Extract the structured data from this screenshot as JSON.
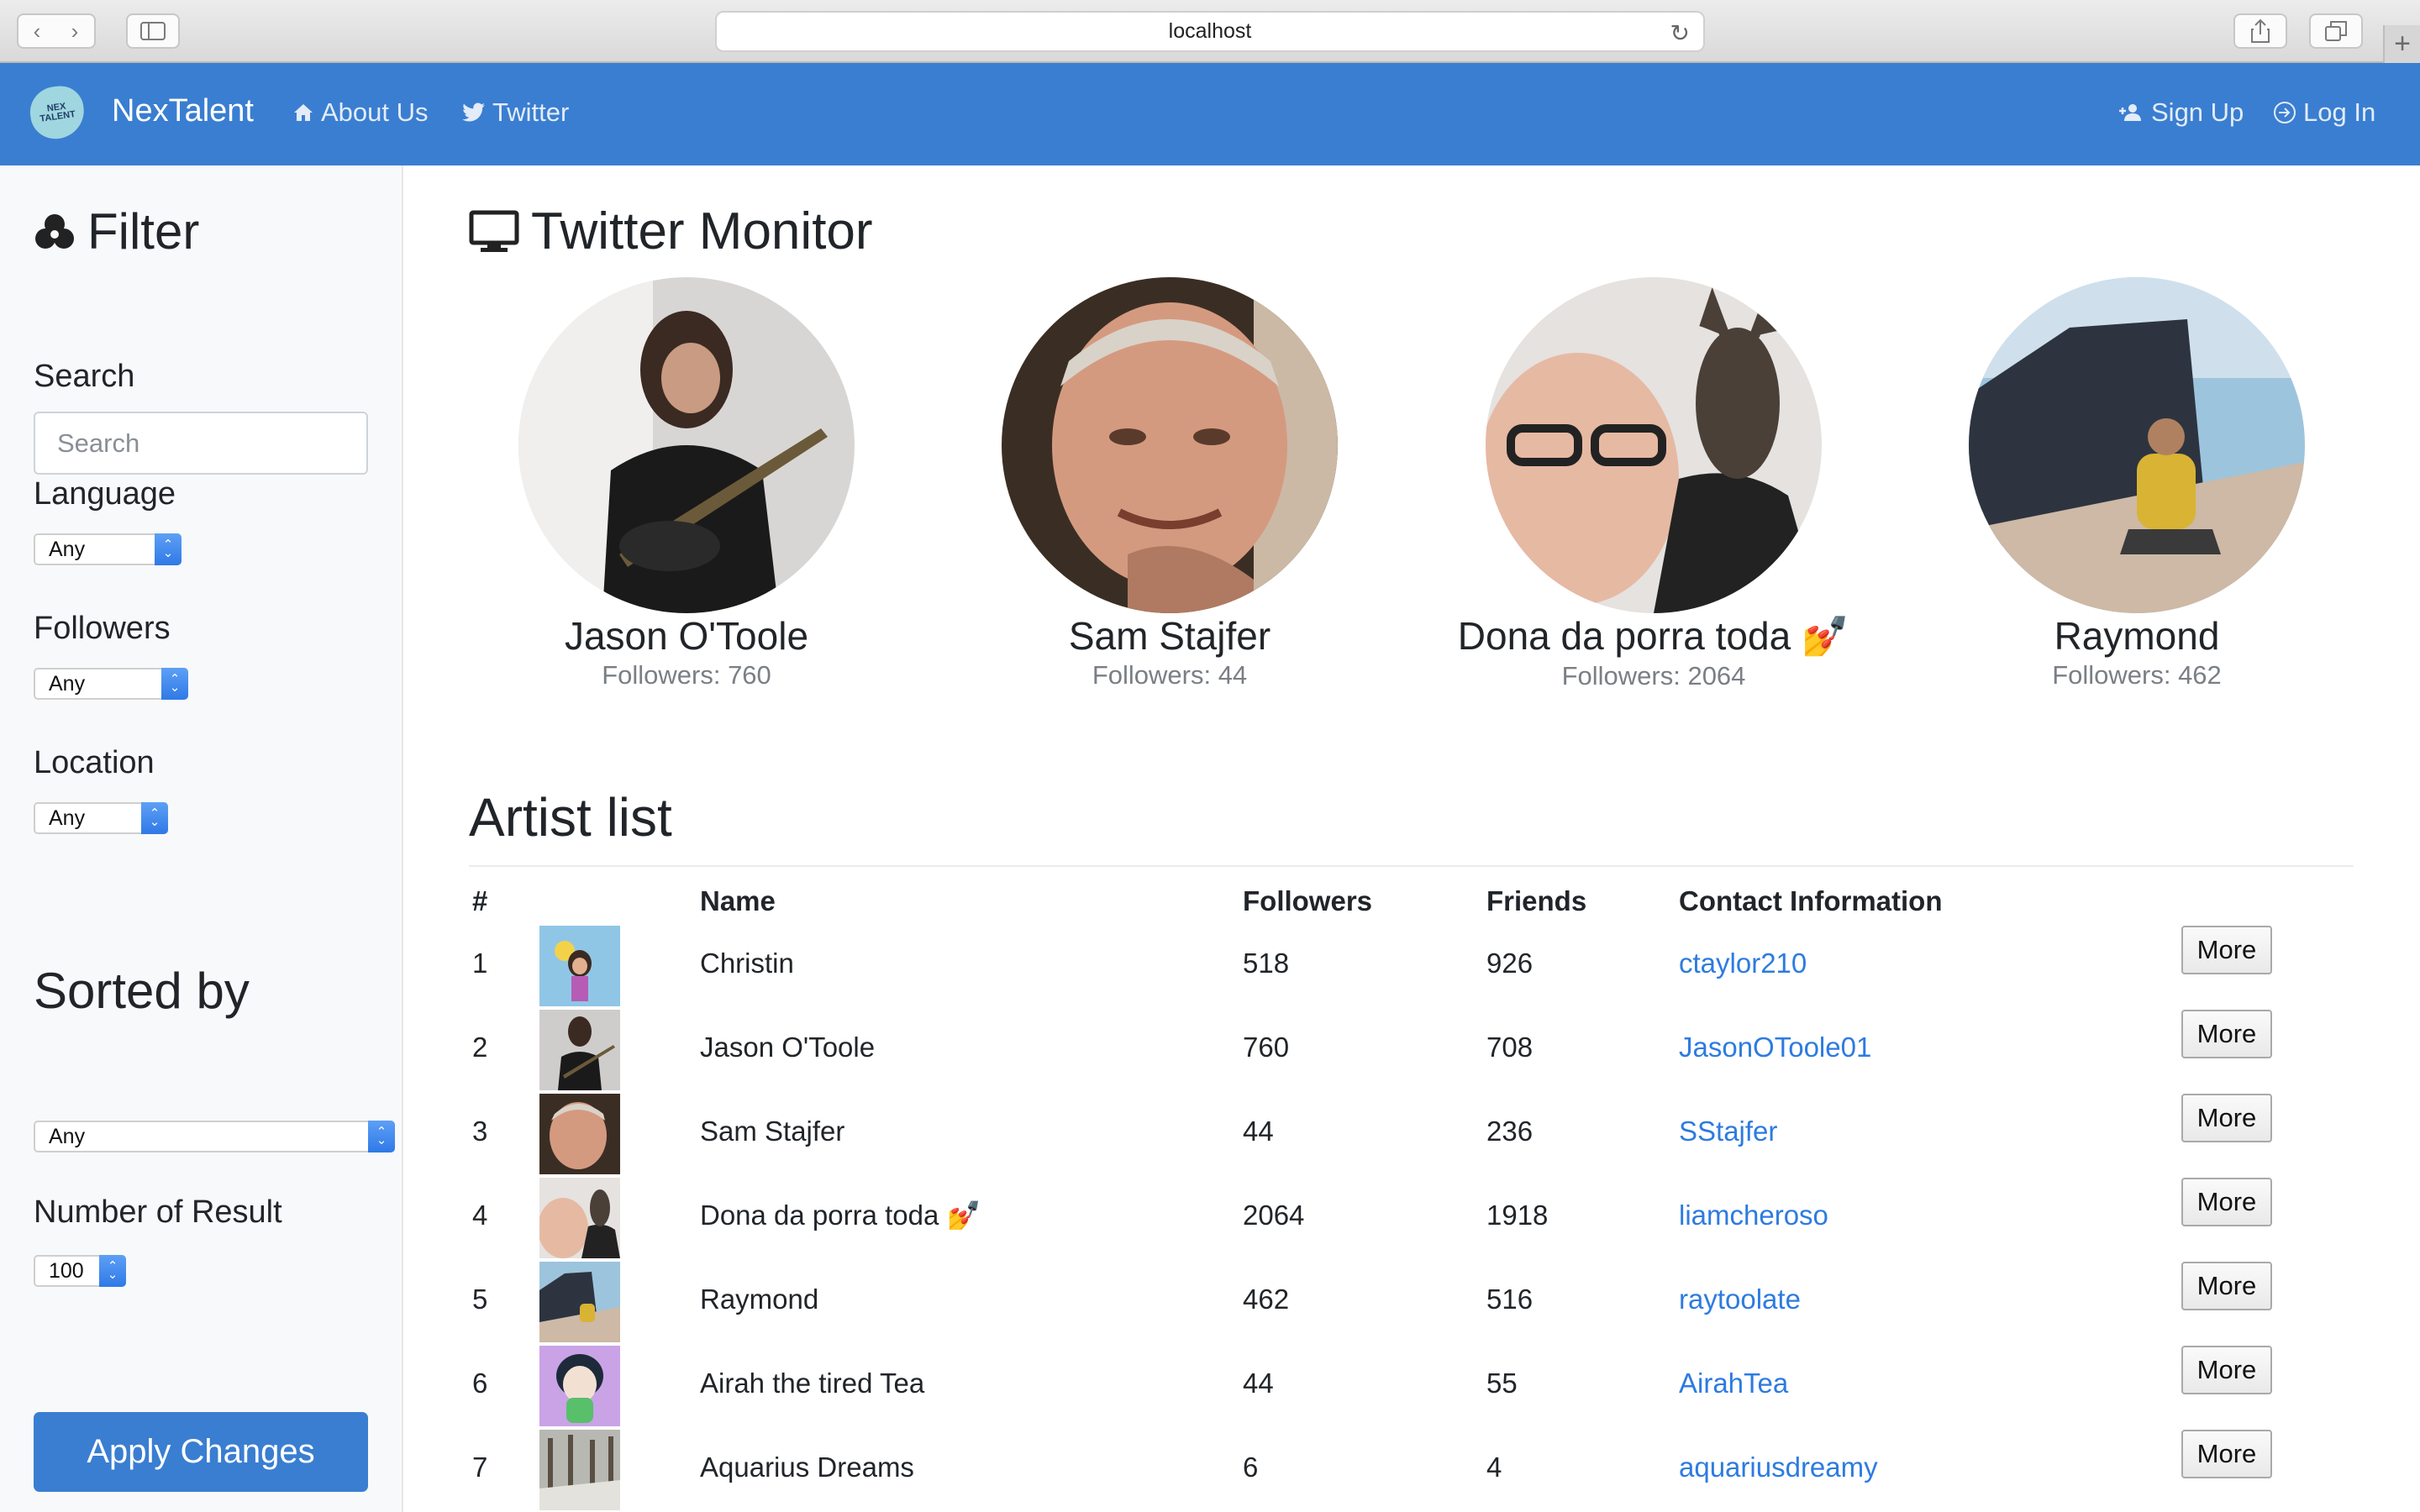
{
  "browser": {
    "url": "localhost"
  },
  "navbar": {
    "brand": "NexTalent",
    "logo_text": "NEX TALENT",
    "about": "About Us",
    "twitter": "Twitter",
    "signup": "Sign Up",
    "login": "Log In",
    "color": "#3a7ed1"
  },
  "sidebar": {
    "filter_title": "Filter",
    "search_label": "Search",
    "search_placeholder": "Search",
    "language_label": "Language",
    "language_value": "Any",
    "followers_label": "Followers",
    "followers_value": "Any",
    "location_label": "Location",
    "location_value": "Any",
    "sorted_title": "Sorted by",
    "sorted_value": "Any",
    "num_label": "Number of Result",
    "num_value": "100",
    "apply": "Apply Changes"
  },
  "monitor": {
    "title": "Twitter Monitor",
    "followers_prefix": "Followers: ",
    "featured": [
      {
        "name": "Jason O'Toole",
        "followers": "760"
      },
      {
        "name": "Sam Stajfer",
        "followers": "44"
      },
      {
        "name": "Dona da porra toda 💅",
        "followers": "2064"
      },
      {
        "name": "Raymond",
        "followers": "462"
      }
    ]
  },
  "artists": {
    "title": "Artist list",
    "headers": {
      "num": "#",
      "name": "Name",
      "followers": "Followers",
      "friends": "Friends",
      "contact": "Contact Information"
    },
    "more_label": "More",
    "rows": [
      {
        "num": "1",
        "name": "Christin",
        "followers": "518",
        "friends": "926",
        "contact": "ctaylor210"
      },
      {
        "num": "2",
        "name": "Jason O'Toole",
        "followers": "760",
        "friends": "708",
        "contact": "JasonOToole01"
      },
      {
        "num": "3",
        "name": "Sam Stajfer",
        "followers": "44",
        "friends": "236",
        "contact": "SStajfer"
      },
      {
        "num": "4",
        "name": "Dona da porra toda 💅",
        "followers": "2064",
        "friends": "1918",
        "contact": "liamcheroso"
      },
      {
        "num": "5",
        "name": "Raymond",
        "followers": "462",
        "friends": "516",
        "contact": "raytoolate"
      },
      {
        "num": "6",
        "name": "Airah the tired Tea",
        "followers": "44",
        "friends": "55",
        "contact": "AirahTea"
      },
      {
        "num": "7",
        "name": "Aquarius Dreams",
        "followers": "6",
        "friends": "4",
        "contact": "aquariusdreamy"
      }
    ]
  }
}
